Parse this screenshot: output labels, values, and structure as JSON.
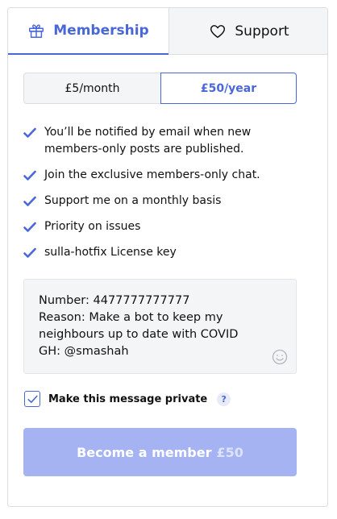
{
  "tabs": [
    {
      "label": "Membership",
      "icon": "gift-icon",
      "active": true
    },
    {
      "label": "Support",
      "icon": "heart-icon",
      "active": false
    }
  ],
  "period": {
    "monthly": "£5/month",
    "yearly": "£50/year",
    "selected": "yearly"
  },
  "benefits": [
    "You’ll be notified by email when new members-only posts are published.",
    "Join the exclusive members-only chat.",
    "Support me on a monthly basis",
    "Priority on issues",
    "sulla-hotfix License key"
  ],
  "message": {
    "value": "Number: 4477777777777\nReason: Make a bot to keep my neighbours up to date with COVID\nGH: @smashah",
    "emoji_icon": "smiley-icon"
  },
  "private": {
    "label": "Make this message private",
    "checked": true,
    "help": "?"
  },
  "cta": {
    "label": "Become a member",
    "price": "£50"
  },
  "colors": {
    "accent": "#4a67d8",
    "cta_background": "#a6b3f3",
    "muted_background": "#f4f5f7"
  }
}
